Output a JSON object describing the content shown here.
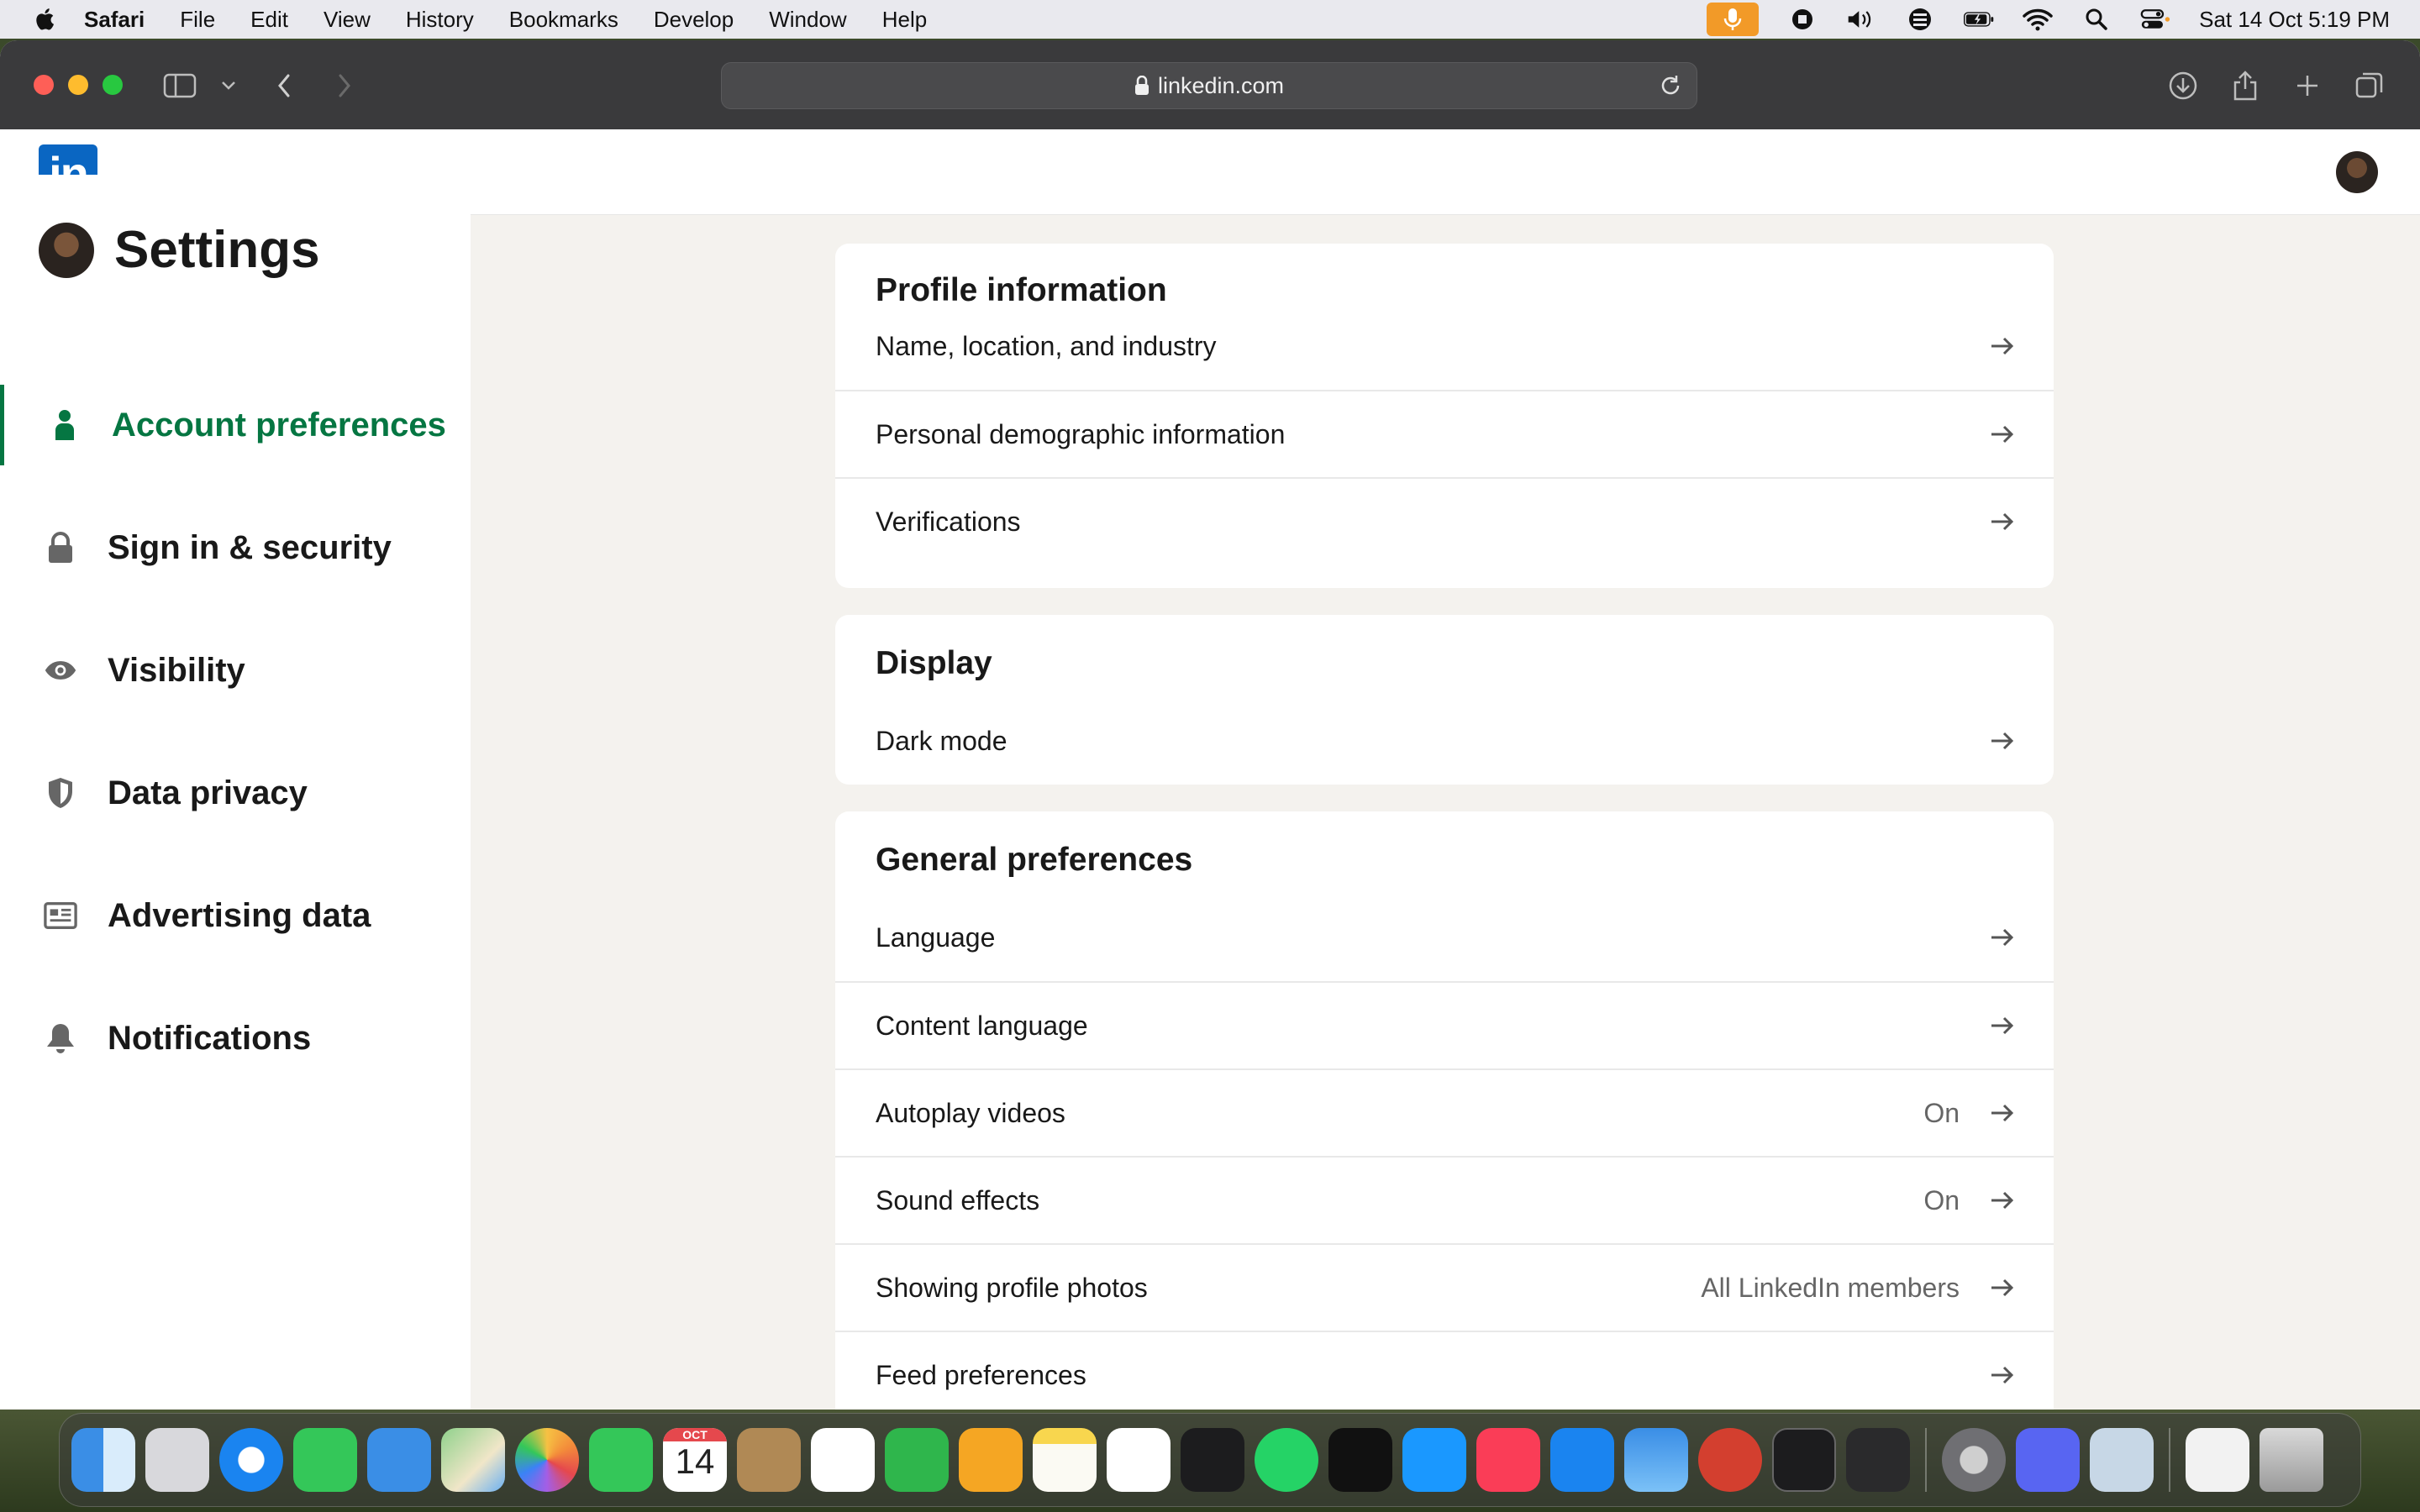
{
  "menubar": {
    "app_name": "Safari",
    "menus": [
      "File",
      "Edit",
      "View",
      "History",
      "Bookmarks",
      "Develop",
      "Window",
      "Help"
    ],
    "clock": "Sat 14 Oct  5:19 PM"
  },
  "browser": {
    "url": "linkedin.com"
  },
  "linkedin": {
    "logo_text": "in"
  },
  "sidebar": {
    "title": "Settings",
    "items": [
      {
        "label": "Account preferences",
        "icon": "person-icon",
        "active": true
      },
      {
        "label": "Sign in & security",
        "icon": "lock-icon"
      },
      {
        "label": "Visibility",
        "icon": "eye-icon"
      },
      {
        "label": "Data privacy",
        "icon": "shield-icon"
      },
      {
        "label": "Advertising data",
        "icon": "newspaper-icon"
      },
      {
        "label": "Notifications",
        "icon": "bell-icon"
      }
    ]
  },
  "sections": {
    "profile": {
      "title": "Profile information",
      "rows": [
        {
          "label": "Name, location, and industry"
        },
        {
          "label": "Personal demographic information"
        },
        {
          "label": "Verifications"
        }
      ]
    },
    "display": {
      "title": "Display",
      "rows": [
        {
          "label": "Dark mode"
        }
      ]
    },
    "general": {
      "title": "General preferences",
      "rows": [
        {
          "label": "Language",
          "value": ""
        },
        {
          "label": "Content language",
          "value": ""
        },
        {
          "label": "Autoplay videos",
          "value": "On"
        },
        {
          "label": "Sound effects",
          "value": "On"
        },
        {
          "label": "Showing profile photos",
          "value": "All LinkedIn members"
        },
        {
          "label": "Feed preferences",
          "value": ""
        }
      ]
    }
  },
  "dock": {
    "calendar_month": "OCT",
    "calendar_day": "14",
    "apps": [
      "finder-icon",
      "launchpad-icon",
      "safari-icon",
      "messages-icon",
      "mail-icon",
      "maps-icon",
      "photos-icon",
      "facetime-icon",
      "calendar-icon",
      "contacts-icon",
      "reminders-icon",
      "numbers-icon",
      "pages-icon",
      "notes-icon",
      "freeform-icon",
      "stocks-icon",
      "whatsapp-icon",
      "appletv-icon",
      "primevideo-icon",
      "music-icon",
      "appstore-icon",
      "weather-icon",
      "remote-desktop-icon",
      "terminal-icon",
      "l-app-icon",
      "system-settings-icon",
      "discord-icon",
      "preview-icon",
      "document-icon",
      "trash-icon"
    ]
  },
  "colors": {
    "linkedin_blue": "#0a66c2",
    "active_green": "#057642",
    "page_bg": "#f4f2ee"
  }
}
